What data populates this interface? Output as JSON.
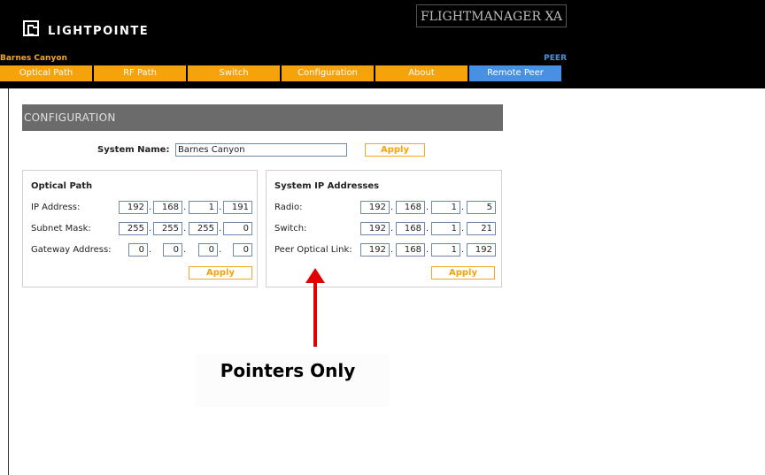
{
  "header": {
    "logo_text": "LIGHTPOINTE",
    "product_title": "FLIGHTMANAGER XA",
    "site_name": "Barnes Canyon",
    "peer_label": "PEER"
  },
  "nav": {
    "tabs": [
      "Optical Path",
      "RF Path",
      "Switch",
      "Configuration",
      "About",
      "Remote Peer"
    ],
    "active": "Remote Peer"
  },
  "page": {
    "section_title": "CONFIGURATION",
    "system_name_label": "System Name:",
    "system_name_value": "Barnes Canyon",
    "apply_label": "Apply"
  },
  "optical_path": {
    "title": "Optical Path",
    "apply_label": "Apply",
    "rows": [
      {
        "label": "IP Address:",
        "octets": [
          "192",
          "168",
          "1",
          "191"
        ]
      },
      {
        "label": "Subnet Mask:",
        "octets": [
          "255",
          "255",
          "255",
          "0"
        ]
      },
      {
        "label": "Gateway Address:",
        "octets": [
          "0",
          "0",
          "0",
          "0"
        ]
      }
    ]
  },
  "system_ip": {
    "title": "System IP Addresses",
    "apply_label": "Apply",
    "rows": [
      {
        "label": "Radio:",
        "octets": [
          "192",
          "168",
          "1",
          "5"
        ]
      },
      {
        "label": "Switch:",
        "octets": [
          "192",
          "168",
          "1",
          "21"
        ]
      },
      {
        "label": "Peer Optical Link:",
        "octets": [
          "192",
          "168",
          "1",
          "192"
        ]
      }
    ]
  },
  "annotation": {
    "text": "Pointers Only"
  },
  "colors": {
    "nav_tab": "#f5a20b",
    "nav_active": "#4a90e2",
    "arrow": "#e00000",
    "section_bar": "#6b6b6b"
  }
}
